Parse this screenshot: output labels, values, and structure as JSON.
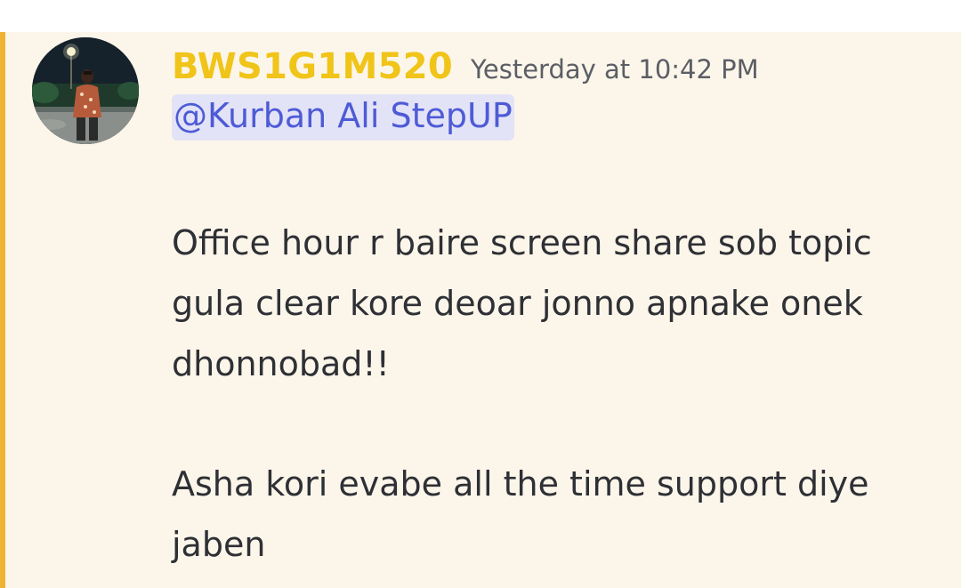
{
  "message": {
    "author": {
      "username": "BWS1G1M520",
      "username_color": "#f0c419",
      "avatar": "avatar-photo-icon"
    },
    "timestamp": "Yesterday at 10:42 PM",
    "mention": "@Kurban Ali StepUP",
    "paragraphs": [
      "Office hour r baire screen share sob topic gula clear kore deoar jonno apnake onek dhonnobad!!",
      "Asha kori evabe all the time support diye jaben"
    ],
    "highlight_color": "#f0b232",
    "background_color": "#fcf6ea"
  }
}
